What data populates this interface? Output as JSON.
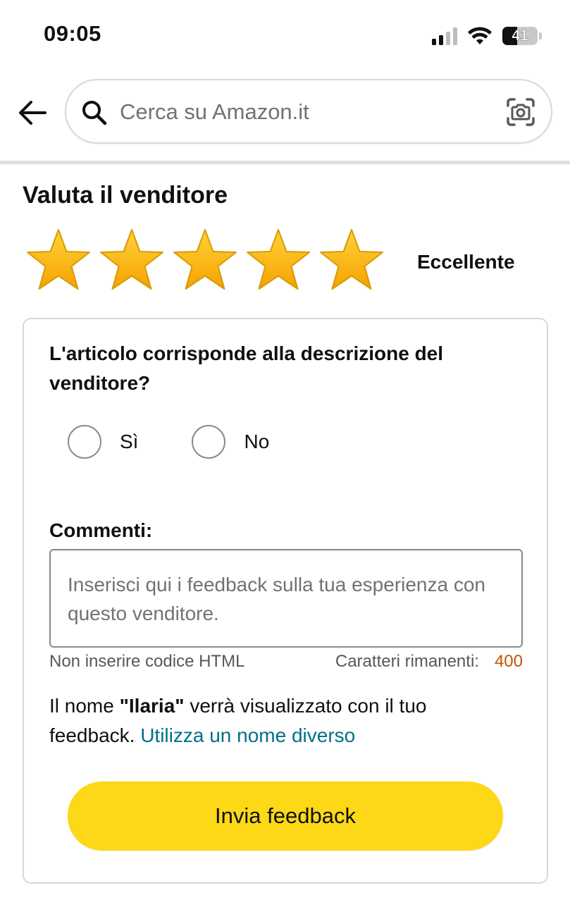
{
  "status_bar": {
    "time": "09:05",
    "battery_level": "41",
    "battery_percent": 41
  },
  "search": {
    "placeholder": "Cerca su Amazon.it"
  },
  "icons": {
    "back": "arrow-left-icon",
    "search": "magnifier-icon",
    "camera": "camera-lens-icon",
    "star": "star-filled-icon",
    "signal": "cellular-signal-icon",
    "wifi": "wifi-icon",
    "battery": "battery-icon"
  },
  "rating": {
    "title": "Valuta il venditore",
    "stars_selected": 5,
    "stars_total": 5,
    "label": "Eccellente"
  },
  "form": {
    "question": "L'articolo corrisponde alla descrizione del venditore?",
    "options": [
      "Sì",
      "No"
    ],
    "comments_label": "Commenti:",
    "comments_placeholder": "Inserisci qui i feedback sulla tua esperienza con questo venditore.",
    "html_hint": "Non inserire codice HTML",
    "remaining_label": "Caratteri rimanenti:",
    "remaining_count": "400",
    "name_prefix": "Il nome ",
    "name_value": "\"Ilaria\"",
    "name_suffix": " verrà visualizzato con il tuo feedback. ",
    "name_link": "Utilizza un nome diverso",
    "submit_label": "Invia feedback"
  },
  "colors": {
    "star_fill": "#ffb800",
    "button_yellow": "#fcd817",
    "link": "#007185",
    "counter": "#c45500"
  }
}
